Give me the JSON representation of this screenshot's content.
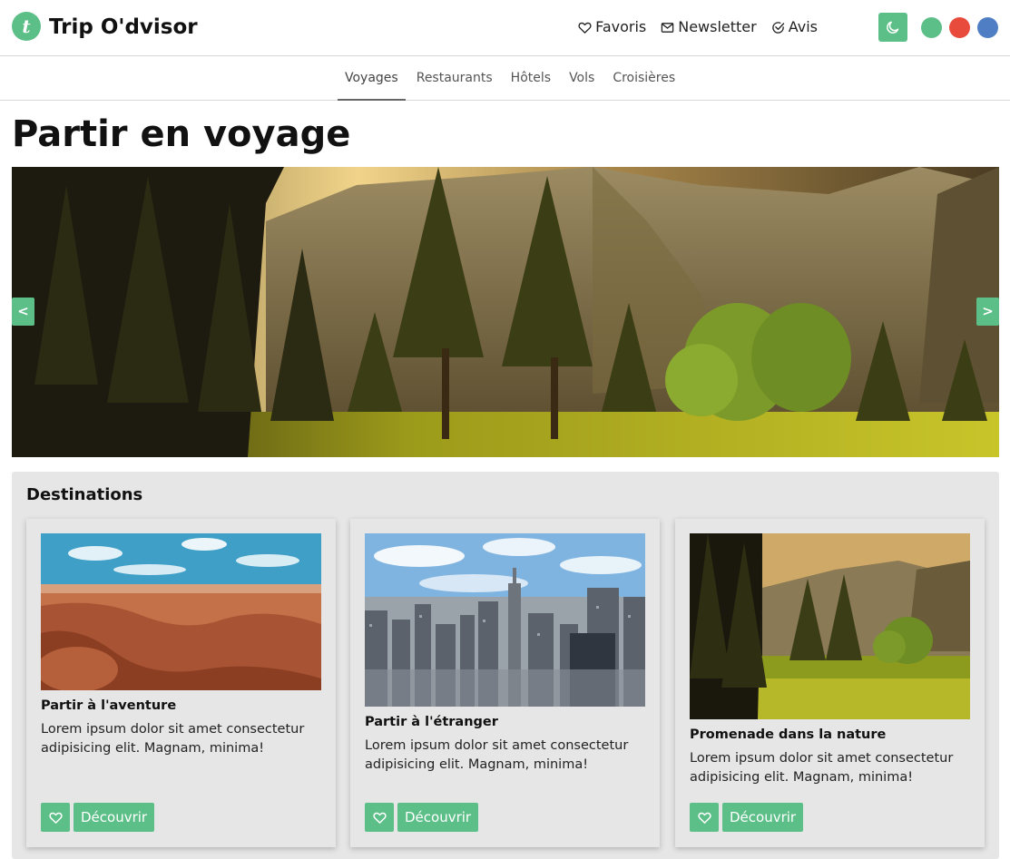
{
  "header": {
    "logo_letter": "t",
    "brand": "Trip O'dvisor",
    "links": [
      {
        "label": "Favoris",
        "icon": "heart-icon"
      },
      {
        "label": "Newsletter",
        "icon": "envelope-icon"
      },
      {
        "label": "Avis",
        "icon": "check-circle-icon"
      }
    ],
    "theme_toggle_icon": "moon-icon",
    "color_swatches": [
      "#5dbf88",
      "#e84b3c",
      "#4f7ec4"
    ]
  },
  "nav": {
    "tabs": [
      {
        "label": "Voyages",
        "active": true
      },
      {
        "label": "Restaurants",
        "active": false
      },
      {
        "label": "Hôtels",
        "active": false
      },
      {
        "label": "Vols",
        "active": false
      },
      {
        "label": "Croisières",
        "active": false
      }
    ]
  },
  "page": {
    "title": "Partir en voyage"
  },
  "carousel": {
    "prev_label": "<",
    "next_label": ">"
  },
  "destinations": {
    "title": "Destinations",
    "cards": [
      {
        "title": "Partir à l'aventure",
        "text": "Lorem ipsum dolor sit amet consectetur adipisicing elit. Magnam, minima!",
        "button": "Découvrir",
        "image": "desert-canyon"
      },
      {
        "title": "Partir à l'étranger",
        "text": "Lorem ipsum dolor sit amet consectetur adipisicing elit. Magnam, minima!",
        "button": "Découvrir",
        "image": "city-skyline"
      },
      {
        "title": "Promenade dans la nature",
        "text": "Lorem ipsum dolor sit amet consectetur adipisicing elit. Magnam, minima!",
        "button": "Découvrir",
        "image": "forest-valley"
      }
    ]
  }
}
